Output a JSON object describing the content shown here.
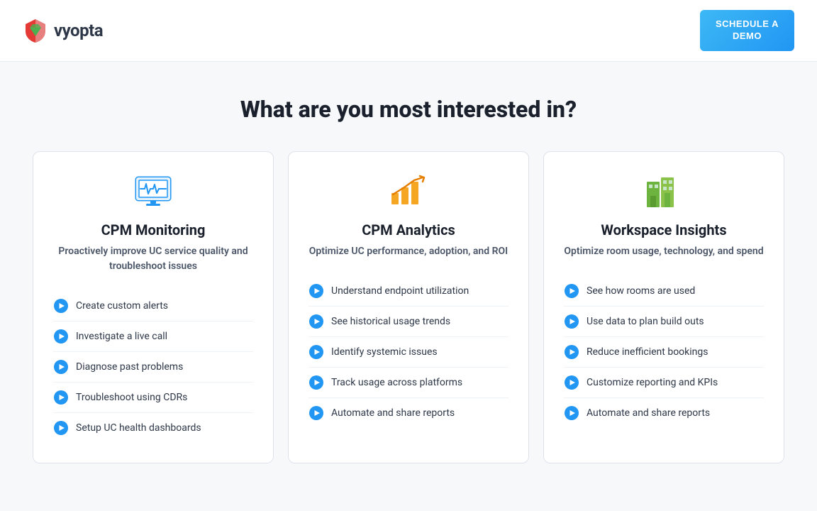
{
  "header": {
    "logo_text": "vyopta",
    "schedule_btn": "SCHEDULE A\nDEMO"
  },
  "main": {
    "title": "What are you most interested in?",
    "cards": [
      {
        "id": "cpm-monitoring",
        "title": "CPM Monitoring",
        "subtitle": "Proactively improve UC service quality and troubleshoot issues",
        "icon_type": "monitor",
        "icon_color": "#2196f3",
        "features": [
          "Create custom alerts",
          "Investigate a live call",
          "Diagnose past problems",
          "Troubleshoot using CDRs",
          "Setup UC health dashboards"
        ]
      },
      {
        "id": "cpm-analytics",
        "title": "CPM Analytics",
        "subtitle": "Optimize UC performance, adoption, and ROI",
        "icon_type": "analytics",
        "icon_color": "#f5a623",
        "features": [
          "Understand endpoint utilization",
          "See historical usage trends",
          "Identify systemic issues",
          "Track usage across platforms",
          "Automate and share reports"
        ]
      },
      {
        "id": "workspace-insights",
        "title": "Workspace Insights",
        "subtitle": "Optimize room usage, technology, and spend",
        "icon_type": "workspace",
        "icon_color": "#6db33f",
        "features": [
          "See how rooms are used",
          "Use data to plan build outs",
          "Reduce inefficient bookings",
          "Customize reporting and KPIs",
          "Automate and share reports"
        ]
      }
    ]
  },
  "icons": {
    "play_circle_color": "#2196f3"
  }
}
